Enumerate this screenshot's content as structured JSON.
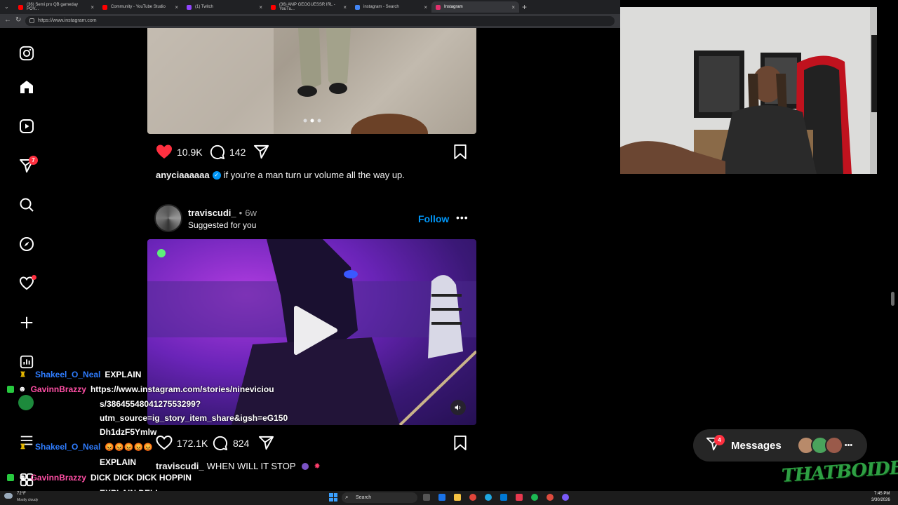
{
  "browser": {
    "tabs": [
      {
        "title": "(36) Semi pro QB gameday POV...",
        "color": "#ff0000"
      },
      {
        "title": "Community - YouTube Studio",
        "color": "#ff0000"
      },
      {
        "title": "(1) Twitch",
        "color": "#9146ff"
      },
      {
        "title": "(36) AMP GEOGUESSR IRL - YouTu...",
        "color": "#ff0000"
      },
      {
        "title": "instagram - Search",
        "color": "#4285f4"
      },
      {
        "title": "Instagram",
        "color": "#e1306c"
      }
    ],
    "url": "https://www.instagram.com"
  },
  "sidebar": {
    "notifications_badge": "7"
  },
  "post1": {
    "likes": "10.9K",
    "comments": "142",
    "username": "anyciaaaaaa",
    "caption": "if you're a man turn ur volume all the way up."
  },
  "post2": {
    "username": "traviscudi_",
    "age": "6w",
    "separator": "•",
    "subtitle": "Suggested for you",
    "follow_label": "Follow",
    "likes": "172.1K",
    "comments": "824",
    "caption_user": "traviscudi_",
    "caption": "WHEN WILL IT STOP"
  },
  "messages": {
    "label": "Messages",
    "badge": "4"
  },
  "watermark": "THATBOIDELI",
  "chat": [
    {
      "user": "Shakeel_O_Neal",
      "msg": "EXPLAIN"
    },
    {
      "user": "GavinnBrazzy",
      "msg": "https://www.instagram.com/stories/nineviciou"
    },
    {
      "msg": "s/3864554804127553299?"
    },
    {
      "msg": "utm_source=ig_story_item_share&igsh=eG150"
    },
    {
      "msg": "Dh1dzF5Ymlw"
    },
    {
      "user": "Shakeel_O_Neal",
      "msg": "😡😡😡😡😡"
    },
    {
      "msg": "EXPLAIN"
    },
    {
      "user": "GavinnBrazzy",
      "msg": "DICK DICK DICK HOPPIN"
    },
    {
      "msg": "EXPLAIN DELI"
    }
  ],
  "taskbar": {
    "weather_temp": "72°F",
    "weather_desc": "Mostly cloudy",
    "search_label": "Search",
    "time": "7:45 PM",
    "date": "3/30/2026"
  }
}
